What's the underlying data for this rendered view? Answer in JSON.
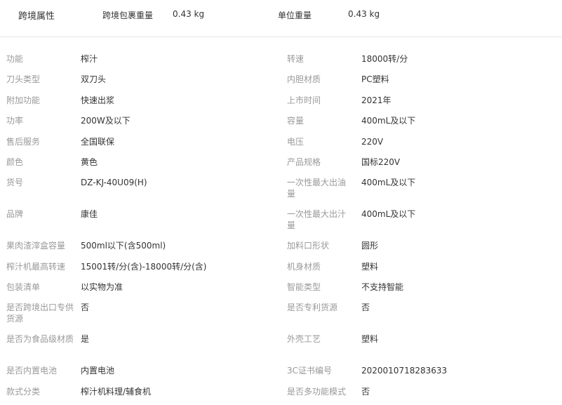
{
  "header": {
    "title": "跨境属性",
    "package_weight_label": "跨境包裹重量",
    "package_weight_value": "0.43 kg",
    "unit_weight_label": "单位重量",
    "unit_weight_value": "0.43 kg"
  },
  "left": [
    {
      "label": "功能",
      "value": "榨汁"
    },
    {
      "label": "刀头类型",
      "value": "双刀头"
    },
    {
      "label": "附加功能",
      "value": "快速出浆"
    },
    {
      "label": "功率",
      "value": "200W及以下"
    },
    {
      "label": "售后服务",
      "value": "全国联保"
    },
    {
      "label": "颜色",
      "value": "黄色"
    },
    {
      "label": "货号",
      "value": "DZ-KJ-40U09(H)"
    },
    {
      "label": "品牌",
      "value": "康佳"
    },
    {
      "label": "果肉渣滓盒容量",
      "value": "500ml以下(含500ml)"
    },
    {
      "label": "榨汁机最高转速",
      "value": "15001转/分(含)-18000转/分(含)"
    },
    {
      "label": "包装清单",
      "value": "以实物为准"
    },
    {
      "label": "是否跨境出口专供货源",
      "value": "否"
    },
    {
      "label": "是否为食品级材质",
      "value": "是"
    },
    {
      "label": "是否内置电池",
      "value": "内置电池"
    },
    {
      "label": "款式分类",
      "value": "榨汁机料理/辅食机"
    }
  ],
  "right": [
    {
      "label": "转速",
      "value": "18000转/分"
    },
    {
      "label": "内胆材质",
      "value": "PC塑料"
    },
    {
      "label": "上市时间",
      "value": "2021年"
    },
    {
      "label": "容量",
      "value": "400mL及以下"
    },
    {
      "label": "电压",
      "value": "220V"
    },
    {
      "label": "产品规格",
      "value": "国标220V"
    },
    {
      "label": "一次性最大出油量",
      "value": "400mL及以下"
    },
    {
      "label": "一次性最大出汁量",
      "value": "400mL及以下"
    },
    {
      "label": "加料口形状",
      "value": "圆形"
    },
    {
      "label": "机身材质",
      "value": "塑料"
    },
    {
      "label": "智能类型",
      "value": "不支持智能"
    },
    {
      "label": "是否专利货源",
      "value": "否"
    },
    {
      "label": "外壳工艺",
      "value": "塑料"
    },
    {
      "label": "3C证书编号",
      "value": "2020010718283633"
    },
    {
      "label": "是否多功能模式",
      "value": "否"
    }
  ]
}
